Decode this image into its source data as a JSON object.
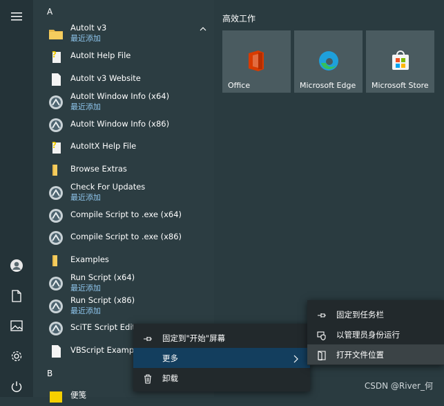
{
  "colors": {
    "background": "#2a3b40",
    "accent_sub": "#8fc6ee",
    "menu_bg": "#22292c",
    "highlight": "#133e5e"
  },
  "rail": {
    "items": [
      {
        "icon": "hamburger-menu-icon"
      },
      {
        "icon": "user-icon"
      },
      {
        "icon": "document-icon"
      },
      {
        "icon": "pictures-icon"
      },
      {
        "icon": "settings-gear-icon"
      },
      {
        "icon": "power-icon"
      }
    ]
  },
  "applist": {
    "letters": [
      "A",
      "B"
    ],
    "apps": [
      {
        "name": "AutoIt v3",
        "sub": "最近添加",
        "icon": "folder-icon"
      },
      {
        "name": "AutoIt Help File",
        "sub": "",
        "icon": "help-file-icon"
      },
      {
        "name": "AutoIt v3 Website",
        "sub": "",
        "icon": "document-icon"
      },
      {
        "name": "AutoIt Window Info (x64)",
        "sub": "最近添加",
        "icon": "autoit-icon"
      },
      {
        "name": "AutoIt Window Info (x86)",
        "sub": "",
        "icon": "autoit-icon"
      },
      {
        "name": "AutoItX Help File",
        "sub": "",
        "icon": "help-file-icon"
      },
      {
        "name": "Browse Extras",
        "sub": "",
        "icon": "folder-icon"
      },
      {
        "name": "Check For Updates",
        "sub": "最近添加",
        "icon": "autoit-icon"
      },
      {
        "name": "Compile Script to .exe (x64)",
        "sub": "",
        "icon": "autoit-icon"
      },
      {
        "name": "Compile Script to .exe (x86)",
        "sub": "",
        "icon": "autoit-icon"
      },
      {
        "name": "Examples",
        "sub": "",
        "icon": "folder-icon"
      },
      {
        "name": "Run Script (x64)",
        "sub": "最近添加",
        "icon": "autoit-icon"
      },
      {
        "name": "Run Script (x86)",
        "sub": "最近添加",
        "icon": "autoit-icon"
      },
      {
        "name": "SciTE Script Edit",
        "sub": "",
        "icon": "autoit-icon"
      },
      {
        "name": "VBScript Examp",
        "sub": "",
        "icon": "document-icon"
      },
      {
        "name": "便笺",
        "sub": "",
        "icon": "sticky-notes-icon"
      }
    ]
  },
  "tiles": {
    "group_title": "高效工作",
    "items": [
      {
        "label": "Office",
        "icon": "office-icon"
      },
      {
        "label": "Microsoft Edge",
        "icon": "edge-icon"
      },
      {
        "label": "Microsoft Store",
        "icon": "store-icon"
      }
    ]
  },
  "context_menu": {
    "items": [
      {
        "label": "固定到\"开始\"屏幕",
        "icon": "pin-icon"
      },
      {
        "label": "更多",
        "icon": "",
        "arrow": "chevron-right-icon"
      },
      {
        "label": "卸载",
        "icon": "trash-icon"
      }
    ]
  },
  "submenu": {
    "items": [
      {
        "label": "固定到任务栏",
        "icon": "pin-icon"
      },
      {
        "label": "以管理员身份运行",
        "icon": "shield-icon"
      },
      {
        "label": "打开文件位置",
        "icon": "open-folder-icon"
      }
    ]
  },
  "watermark": "CSDN @River_何"
}
